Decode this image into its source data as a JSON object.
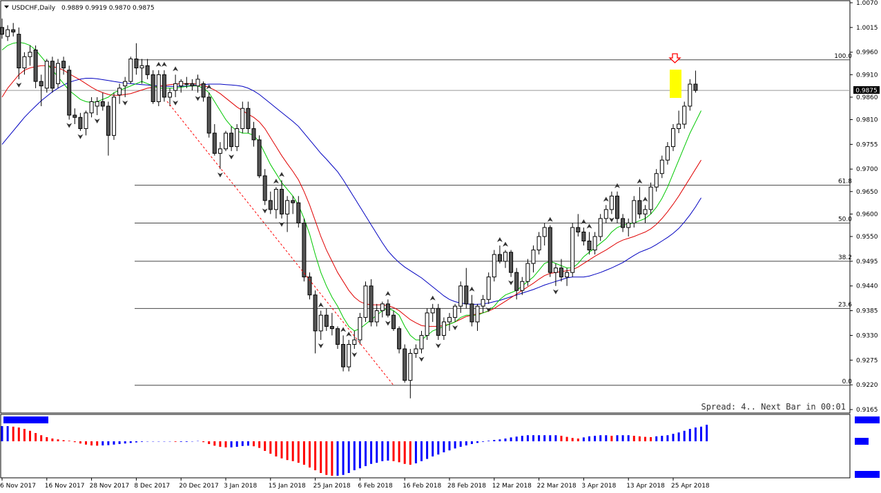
{
  "header": {
    "symbol": "USDCHF,Daily",
    "ohlc": "0.9889 0.9919 0.9870 0.9875"
  },
  "status_text": "Spread: 4.. Next Bar in 00:01",
  "current_price_label": "0.9875",
  "indicator_labels": {
    "name": "",
    "top_value": "",
    "mid_value": "",
    "bottom_value": ""
  },
  "fib_levels": [
    {
      "label": "100.0",
      "price": 0.9943
    },
    {
      "label": "61.8",
      "price": 0.9664
    },
    {
      "label": "50.0",
      "price": 0.958
    },
    {
      "label": "38.2",
      "price": 0.9495
    },
    {
      "label": "23.6",
      "price": 0.939
    },
    {
      "label": "0.0",
      "price": 0.9219
    }
  ],
  "colors": {
    "bull_body": "#ffffff",
    "bear_body": "#555555",
    "ma_fast": "#00c800",
    "ma_mid": "#e00000",
    "ma_slow": "#0000c0",
    "hist_up": "#0000ff",
    "hist_down": "#ff0000",
    "highlight": "#ffff00",
    "arrow": "#ff0000"
  },
  "chart_data": {
    "type": "candlestick",
    "y_ticks": [
      "1.0070",
      "1.0015",
      "0.9960",
      "0.9910",
      "0.9860",
      "0.9810",
      "0.9755",
      "0.9700",
      "0.9650",
      "0.9600",
      "0.9550",
      "0.9495",
      "0.9440",
      "0.9385",
      "0.9330",
      "0.9275",
      "0.9220",
      "0.9165"
    ],
    "ylim": [
      0.9165,
      1.007
    ],
    "x_tick_labels": [
      "6 Nov 2017",
      "16 Nov 2017",
      "28 Nov 2017",
      "8 Dec 2017",
      "20 Dec 2017",
      "3 Jan 2018",
      "15 Jan 2018",
      "25 Jan 2018",
      "6 Feb 2018",
      "16 Feb 2018",
      "28 Feb 2018",
      "12 Mar 2018",
      "22 Mar 2018",
      "3 Apr 2018",
      "13 Apr 2018",
      "25 Apr 2018"
    ],
    "x_tick_index": [
      0,
      8,
      16,
      24,
      32,
      40,
      48,
      56,
      64,
      72,
      80,
      88,
      96,
      104,
      112,
      120
    ],
    "candles": [
      [
        1.0015,
        1.0035,
        0.999,
        1.0
      ],
      [
        0.9995,
        1.002,
        0.9985,
        1.001
      ],
      [
        1.001,
        1.0025,
        0.9995,
        1.0005
      ],
      [
        1.0,
        1.0015,
        0.99,
        0.9925
      ],
      [
        0.9925,
        0.996,
        0.991,
        0.995
      ],
      [
        0.995,
        0.9975,
        0.993,
        0.996
      ],
      [
        0.9965,
        0.9975,
        0.988,
        0.9895
      ],
      [
        0.9895,
        0.991,
        0.984,
        0.9885
      ],
      [
        0.988,
        0.9945,
        0.987,
        0.994
      ],
      [
        0.994,
        0.995,
        0.987,
        0.988
      ],
      [
        0.989,
        0.9945,
        0.988,
        0.9935
      ],
      [
        0.994,
        0.995,
        0.991,
        0.9925
      ],
      [
        0.992,
        0.993,
        0.981,
        0.982
      ],
      [
        0.982,
        0.9835,
        0.98,
        0.9815
      ],
      [
        0.9815,
        0.9825,
        0.9785,
        0.979
      ],
      [
        0.979,
        0.983,
        0.9775,
        0.9825
      ],
      [
        0.9825,
        0.986,
        0.9815,
        0.985
      ],
      [
        0.984,
        0.986,
        0.982,
        0.985
      ],
      [
        0.985,
        0.987,
        0.983,
        0.984
      ],
      [
        0.984,
        0.985,
        0.973,
        0.9775
      ],
      [
        0.9775,
        0.987,
        0.9765,
        0.986
      ],
      [
        0.9865,
        0.989,
        0.9845,
        0.988
      ],
      [
        0.9885,
        0.9905,
        0.986,
        0.9895
      ],
      [
        0.9895,
        0.995,
        0.989,
        0.9945
      ],
      [
        0.9945,
        0.998,
        0.991,
        0.9925
      ],
      [
        0.9925,
        0.9945,
        0.989,
        0.993
      ],
      [
        0.993,
        0.9945,
        0.99,
        0.991
      ],
      [
        0.991,
        0.992,
        0.9845,
        0.985
      ],
      [
        0.985,
        0.992,
        0.984,
        0.991
      ],
      [
        0.991,
        0.992,
        0.985,
        0.986
      ],
      [
        0.986,
        0.988,
        0.984,
        0.987
      ],
      [
        0.9875,
        0.991,
        0.986,
        0.989
      ],
      [
        0.9885,
        0.99,
        0.987,
        0.9895
      ],
      [
        0.989,
        0.9905,
        0.988,
        0.989
      ],
      [
        0.989,
        0.99,
        0.9875,
        0.9885
      ],
      [
        0.9885,
        0.991,
        0.987,
        0.99
      ],
      [
        0.989,
        0.9895,
        0.985,
        0.986
      ],
      [
        0.986,
        0.987,
        0.977,
        0.978
      ],
      [
        0.978,
        0.98,
        0.973,
        0.9735
      ],
      [
        0.9735,
        0.976,
        0.97,
        0.9745
      ],
      [
        0.9745,
        0.9785,
        0.974,
        0.978
      ],
      [
        0.978,
        0.9795,
        0.974,
        0.975
      ],
      [
        0.975,
        0.98,
        0.974,
        0.979
      ],
      [
        0.979,
        0.985,
        0.978,
        0.9835
      ],
      [
        0.9835,
        0.985,
        0.978,
        0.979
      ],
      [
        0.979,
        0.9805,
        0.975,
        0.9765
      ],
      [
        0.9765,
        0.9775,
        0.968,
        0.9685
      ],
      [
        0.9685,
        0.97,
        0.962,
        0.963
      ],
      [
        0.963,
        0.965,
        0.96,
        0.961
      ],
      [
        0.961,
        0.966,
        0.959,
        0.9655
      ],
      [
        0.9655,
        0.9675,
        0.959,
        0.96
      ],
      [
        0.96,
        0.964,
        0.956,
        0.963
      ],
      [
        0.963,
        0.964,
        0.96,
        0.9625
      ],
      [
        0.9625,
        0.964,
        0.957,
        0.958
      ],
      [
        0.958,
        0.959,
        0.945,
        0.946
      ],
      [
        0.946,
        0.947,
        0.941,
        0.942
      ],
      [
        0.942,
        0.943,
        0.929,
        0.934
      ],
      [
        0.934,
        0.9385,
        0.932,
        0.9375
      ],
      [
        0.9375,
        0.939,
        0.934,
        0.935
      ],
      [
        0.935,
        0.938,
        0.933,
        0.9345
      ],
      [
        0.9345,
        0.935,
        0.93,
        0.931
      ],
      [
        0.931,
        0.933,
        0.925,
        0.926
      ],
      [
        0.926,
        0.932,
        0.925,
        0.931
      ],
      [
        0.931,
        0.934,
        0.93,
        0.932
      ],
      [
        0.932,
        0.938,
        0.931,
        0.937
      ],
      [
        0.937,
        0.945,
        0.936,
        0.944
      ],
      [
        0.944,
        0.9455,
        0.935,
        0.936
      ],
      [
        0.936,
        0.94,
        0.935,
        0.9385
      ],
      [
        0.9385,
        0.9405,
        0.937,
        0.94
      ],
      [
        0.94,
        0.941,
        0.937,
        0.9375
      ],
      [
        0.9375,
        0.9385,
        0.934,
        0.9345
      ],
      [
        0.9345,
        0.935,
        0.929,
        0.93
      ],
      [
        0.93,
        0.931,
        0.9225,
        0.923
      ],
      [
        0.923,
        0.93,
        0.919,
        0.929
      ],
      [
        0.929,
        0.931,
        0.928,
        0.93
      ],
      [
        0.93,
        0.934,
        0.929,
        0.933
      ],
      [
        0.933,
        0.939,
        0.932,
        0.938
      ],
      [
        0.938,
        0.94,
        0.936,
        0.939
      ],
      [
        0.939,
        0.94,
        0.932,
        0.933
      ],
      [
        0.933,
        0.937,
        0.932,
        0.936
      ],
      [
        0.936,
        0.938,
        0.934,
        0.937
      ],
      [
        0.937,
        0.94,
        0.936,
        0.9395
      ],
      [
        0.9395,
        0.945,
        0.938,
        0.944
      ],
      [
        0.944,
        0.948,
        0.939,
        0.94
      ],
      [
        0.94,
        0.942,
        0.935,
        0.936
      ],
      [
        0.936,
        0.94,
        0.934,
        0.9395
      ],
      [
        0.9395,
        0.942,
        0.938,
        0.941
      ],
      [
        0.941,
        0.947,
        0.94,
        0.946
      ],
      [
        0.946,
        0.952,
        0.945,
        0.951
      ],
      [
        0.951,
        0.953,
        0.949,
        0.9495
      ],
      [
        0.9495,
        0.952,
        0.948,
        0.9515
      ],
      [
        0.9515,
        0.952,
        0.946,
        0.947
      ],
      [
        0.947,
        0.948,
        0.941,
        0.943
      ],
      [
        0.943,
        0.946,
        0.942,
        0.945
      ],
      [
        0.945,
        0.95,
        0.944,
        0.949
      ],
      [
        0.949,
        0.953,
        0.947,
        0.952
      ],
      [
        0.952,
        0.956,
        0.951,
        0.955
      ],
      [
        0.955,
        0.958,
        0.953,
        0.957
      ],
      [
        0.957,
        0.9575,
        0.946,
        0.947
      ],
      [
        0.947,
        0.949,
        0.944,
        0.948
      ],
      [
        0.948,
        0.95,
        0.945,
        0.946
      ],
      [
        0.946,
        0.948,
        0.944,
        0.947
      ],
      [
        0.947,
        0.958,
        0.946,
        0.957
      ],
      [
        0.957,
        0.96,
        0.955,
        0.956
      ],
      [
        0.956,
        0.957,
        0.953,
        0.954
      ],
      [
        0.954,
        0.956,
        0.951,
        0.952
      ],
      [
        0.952,
        0.956,
        0.951,
        0.955
      ],
      [
        0.955,
        0.96,
        0.954,
        0.959
      ],
      [
        0.959,
        0.962,
        0.958,
        0.961
      ],
      [
        0.961,
        0.965,
        0.96,
        0.964
      ],
      [
        0.964,
        0.965,
        0.958,
        0.959
      ],
      [
        0.959,
        0.96,
        0.956,
        0.957
      ],
      [
        0.957,
        0.959,
        0.955,
        0.958
      ],
      [
        0.958,
        0.964,
        0.957,
        0.963
      ],
      [
        0.963,
        0.966,
        0.959,
        0.96
      ],
      [
        0.96,
        0.962,
        0.958,
        0.961
      ],
      [
        0.961,
        0.967,
        0.96,
        0.966
      ],
      [
        0.966,
        0.97,
        0.965,
        0.969
      ],
      [
        0.969,
        0.973,
        0.968,
        0.972
      ],
      [
        0.972,
        0.976,
        0.971,
        0.975
      ],
      [
        0.975,
        0.98,
        0.974,
        0.979
      ],
      [
        0.979,
        0.983,
        0.978,
        0.98
      ],
      [
        0.98,
        0.985,
        0.979,
        0.984
      ],
      [
        0.984,
        0.99,
        0.983,
        0.9889
      ],
      [
        0.9889,
        0.9919,
        0.987,
        0.9875
      ]
    ],
    "ma_fast": [
      0.9965,
      0.9975,
      0.998,
      0.9982,
      0.998,
      0.9975,
      0.9965,
      0.995,
      0.9935,
      0.992,
      0.9905,
      0.989,
      0.9875,
      0.9865,
      0.9855,
      0.985,
      0.9848,
      0.985,
      0.9855,
      0.986,
      0.987,
      0.9875,
      0.988,
      0.9885,
      0.989,
      0.9895,
      0.989,
      0.9885,
      0.988,
      0.988,
      0.988,
      0.988,
      0.9882,
      0.9884,
      0.9885,
      0.9885,
      0.988,
      0.987,
      0.985,
      0.983,
      0.981,
      0.9795,
      0.9785,
      0.978,
      0.978,
      0.9775,
      0.976,
      0.9735,
      0.971,
      0.969,
      0.967,
      0.9655,
      0.964,
      0.962,
      0.959,
      0.9555,
      0.951,
      0.947,
      0.944,
      0.9415,
      0.9395,
      0.937,
      0.935,
      0.934,
      0.9345,
      0.9355,
      0.9365,
      0.9375,
      0.9385,
      0.939,
      0.9385,
      0.9375,
      0.935,
      0.933,
      0.932,
      0.932,
      0.933,
      0.934,
      0.9345,
      0.935,
      0.9355,
      0.936,
      0.937,
      0.9375,
      0.9375,
      0.9375,
      0.938,
      0.9385,
      0.9395,
      0.941,
      0.942,
      0.9425,
      0.943,
      0.944,
      0.945,
      0.946,
      0.9475,
      0.949,
      0.9495,
      0.949,
      0.9485,
      0.948,
      0.948,
      0.949,
      0.9505,
      0.9515,
      0.9525,
      0.9535,
      0.9545,
      0.956,
      0.957,
      0.9575,
      0.9578,
      0.958,
      0.9585,
      0.959,
      0.96,
      0.9615,
      0.9635,
      0.966,
      0.969,
      0.972,
      0.975,
      0.978,
      0.9805,
      0.983
    ],
    "ma_mid": [
      0.986,
      0.988,
      0.9895,
      0.991,
      0.992,
      0.9925,
      0.9928,
      0.993,
      0.993,
      0.9928,
      0.9925,
      0.992,
      0.9912,
      0.9905,
      0.9898,
      0.989,
      0.9882,
      0.9875,
      0.987,
      0.9866,
      0.9864,
      0.9864,
      0.9866,
      0.9868,
      0.9872,
      0.9876,
      0.988,
      0.9882,
      0.9884,
      0.9886,
      0.9888,
      0.9889,
      0.989,
      0.989,
      0.989,
      0.9889,
      0.9886,
      0.9882,
      0.9876,
      0.9868,
      0.9858,
      0.9848,
      0.9838,
      0.983,
      0.9822,
      0.9815,
      0.9805,
      0.979,
      0.977,
      0.975,
      0.973,
      0.9712,
      0.9695,
      0.9676,
      0.965,
      0.962,
      0.9585,
      0.955,
      0.952,
      0.9495,
      0.947,
      0.945,
      0.943,
      0.9415,
      0.9405,
      0.94,
      0.9398,
      0.9398,
      0.9398,
      0.9396,
      0.9392,
      0.9385,
      0.9375,
      0.9365,
      0.9358,
      0.9352,
      0.935,
      0.935,
      0.935,
      0.9352,
      0.9355,
      0.936,
      0.9366,
      0.9372,
      0.9375,
      0.9378,
      0.938,
      0.9384,
      0.939,
      0.9398,
      0.9406,
      0.9414,
      0.9422,
      0.943,
      0.9438,
      0.9446,
      0.9455,
      0.9463,
      0.9468,
      0.947,
      0.9472,
      0.9474,
      0.9476,
      0.9482,
      0.949,
      0.9498,
      0.9506,
      0.9513,
      0.952,
      0.9528,
      0.9536,
      0.9542,
      0.9546,
      0.955,
      0.9555,
      0.956,
      0.9567,
      0.9577,
      0.959,
      0.9605,
      0.9622,
      0.964,
      0.966,
      0.968,
      0.97,
      0.972
    ],
    "ma_slow": [
      0.9755,
      0.977,
      0.9785,
      0.98,
      0.9815,
      0.9828,
      0.984,
      0.9852,
      0.9862,
      0.9872,
      0.988,
      0.9887,
      0.9893,
      0.9897,
      0.99,
      0.9902,
      0.9902,
      0.9901,
      0.9899,
      0.9897,
      0.9895,
      0.9893,
      0.9891,
      0.989,
      0.9889,
      0.9888,
      0.9887,
      0.9886,
      0.9885,
      0.9884,
      0.9884,
      0.9884,
      0.9884,
      0.9885,
      0.9886,
      0.9887,
      0.9888,
      0.9889,
      0.9889,
      0.9889,
      0.9888,
      0.9887,
      0.9886,
      0.9884,
      0.988,
      0.9874,
      0.9866,
      0.9856,
      0.9846,
      0.9836,
      0.9826,
      0.9816,
      0.9806,
      0.9795,
      0.978,
      0.9765,
      0.975,
      0.9735,
      0.9722,
      0.9708,
      0.9694,
      0.9676,
      0.9656,
      0.9636,
      0.9616,
      0.9596,
      0.9576,
      0.9556,
      0.9536,
      0.9518,
      0.9504,
      0.9492,
      0.9482,
      0.9474,
      0.9466,
      0.9458,
      0.9448,
      0.9438,
      0.9428,
      0.9418,
      0.941,
      0.9405,
      0.9402,
      0.94,
      0.9399,
      0.9399,
      0.94,
      0.9402,
      0.9405,
      0.9408,
      0.9412,
      0.9416,
      0.942,
      0.9424,
      0.9428,
      0.9432,
      0.9437,
      0.9442,
      0.9446,
      0.945,
      0.9454,
      0.9458,
      0.946,
      0.946,
      0.946,
      0.9462,
      0.9466,
      0.947,
      0.9475,
      0.948,
      0.9486,
      0.9492,
      0.95,
      0.9508,
      0.9515,
      0.952,
      0.9525,
      0.9532,
      0.954,
      0.9548,
      0.9557,
      0.9568,
      0.9582,
      0.9598,
      0.9616,
      0.9636
    ],
    "histogram": [
      0.55,
      0.55,
      0.53,
      0.5,
      0.45,
      0.38,
      0.3,
      0.22,
      0.15,
      0.1,
      0.07,
      0.04,
      0.02,
      -0.03,
      -0.08,
      -0.12,
      -0.15,
      -0.16,
      -0.15,
      -0.14,
      -0.12,
      -0.1,
      -0.08,
      -0.06,
      -0.04,
      -0.02,
      -0.01,
      -0.01,
      -0.01,
      -0.01,
      -0.01,
      -0.02,
      -0.02,
      -0.02,
      -0.01,
      0.01,
      -0.03,
      -0.1,
      -0.16,
      -0.2,
      -0.22,
      -0.22,
      -0.2,
      -0.17,
      -0.16,
      -0.18,
      -0.24,
      -0.35,
      -0.45,
      -0.55,
      -0.62,
      -0.68,
      -0.72,
      -0.78,
      -0.85,
      -0.95,
      -1.05,
      -1.15,
      -1.22,
      -1.25,
      -1.25,
      -1.22,
      -1.15,
      -1.05,
      -0.98,
      -0.9,
      -0.82,
      -0.78,
      -0.72,
      -0.7,
      -0.72,
      -0.76,
      -0.82,
      -0.85,
      -0.8,
      -0.72,
      -0.64,
      -0.55,
      -0.48,
      -0.4,
      -0.33,
      -0.26,
      -0.2,
      -0.15,
      -0.1,
      -0.06,
      -0.02,
      0.02,
      0.05,
      0.07,
      0.1,
      0.14,
      0.17,
      0.2,
      0.22,
      0.22,
      0.22,
      0.22,
      0.22,
      0.22,
      0.2,
      0.16,
      0.12,
      0.1,
      0.14,
      0.18,
      0.2,
      0.22,
      0.22,
      0.2,
      0.22,
      0.22,
      0.22,
      0.2,
      0.18,
      0.16,
      0.15,
      0.18,
      0.2,
      0.22,
      0.27,
      0.32,
      0.38,
      0.45,
      0.5,
      0.53,
      0.6
    ],
    "fractals_up": [
      28,
      29,
      31,
      37,
      49,
      50,
      57,
      61,
      62,
      69,
      77,
      84,
      89,
      90,
      98,
      104,
      105,
      108,
      110,
      114,
      115
    ],
    "fractals_down": [
      3,
      12,
      14,
      17,
      22,
      31,
      35,
      39,
      41,
      47,
      50,
      57,
      63,
      69,
      75,
      78,
      81,
      87,
      91,
      99,
      109
    ]
  }
}
